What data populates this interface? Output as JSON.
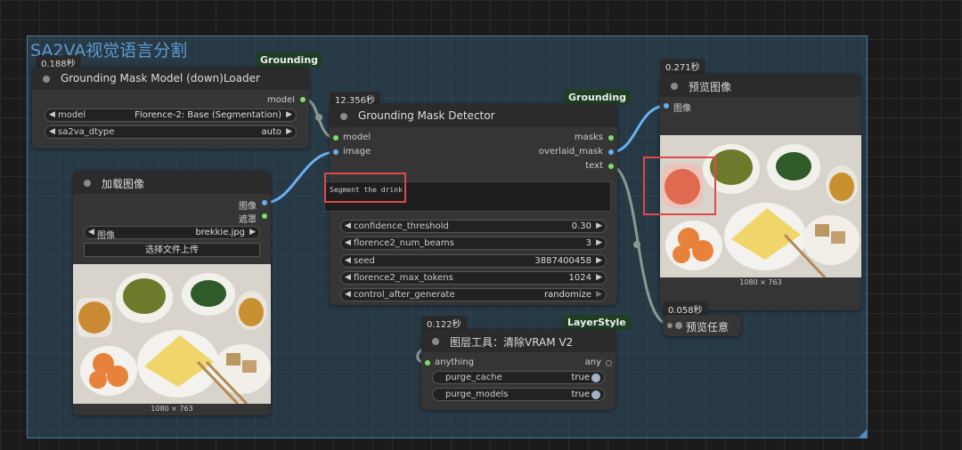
{
  "group": {
    "title": "SA2VA视觉语言分割"
  },
  "loader": {
    "timing": "0.188秒",
    "badge": "Grounding",
    "title": "Grounding Mask Model (down)Loader",
    "output_model": "model",
    "widgets": [
      {
        "label": "model",
        "value": "Florence-2: Base (Segmentation)"
      },
      {
        "label": "sa2va_dtype",
        "value": "auto"
      }
    ]
  },
  "load_image": {
    "title": "加载图像",
    "out_image": "图像",
    "out_mask": "遮罩",
    "image_widget": {
      "label": "图像",
      "value": "brekkie.jpg"
    },
    "upload_button": "选择文件上传",
    "caption": "1080 × 763"
  },
  "detector": {
    "timing": "12.356秒",
    "badge": "Grounding",
    "title": "Grounding Mask Detector",
    "in_model": "model",
    "in_image": "image",
    "out_masks": "masks",
    "out_overlaid": "overlaid_mask",
    "out_text": "text",
    "prompt": "Segment the drink",
    "widgets": [
      {
        "label": "confidence_threshold",
        "value": "0.30"
      },
      {
        "label": "florence2_num_beams",
        "value": "3"
      },
      {
        "label": "seed",
        "value": "3887400458"
      },
      {
        "label": "florence2_max_tokens",
        "value": "1024"
      },
      {
        "label": "control_after_generate",
        "value": "randomize"
      }
    ]
  },
  "preview": {
    "timing": "0.271秒",
    "title": "预览图像",
    "in_image": "图像",
    "caption": "1080 × 763"
  },
  "preview_any": {
    "timing": "0.058秒",
    "title": "预览任意"
  },
  "purge": {
    "timing": "0.122秒",
    "badge": "LayerStyle",
    "title": "图层工具：清除VRAM V2",
    "in_anything": "anything",
    "out_any": "any",
    "toggles": [
      {
        "label": "purge_cache",
        "value": "true"
      },
      {
        "label": "purge_models",
        "value": "true"
      }
    ]
  },
  "colors": {
    "group": "#335269",
    "badge_bg": "#1f3f24",
    "highlight": "#e04848",
    "wire": "#6ab0f0"
  }
}
